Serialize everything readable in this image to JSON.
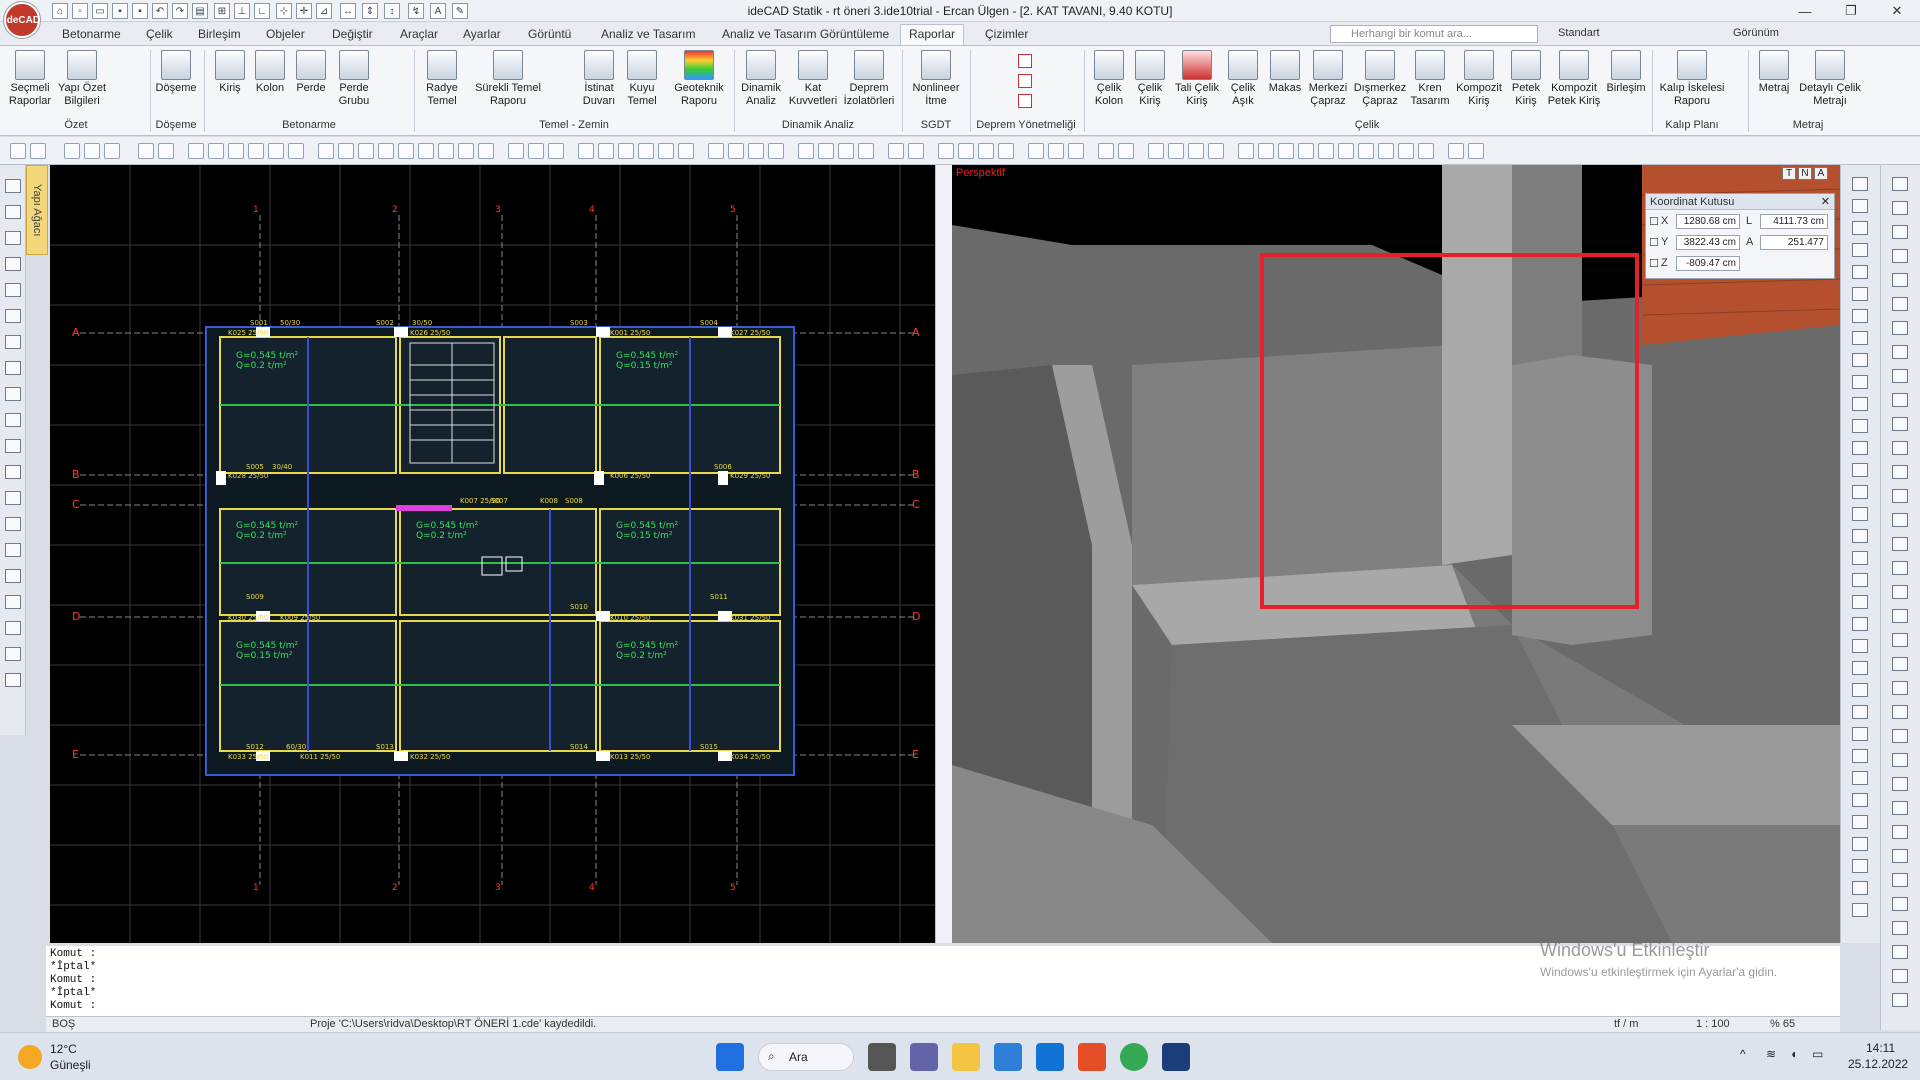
{
  "window": {
    "title": "ideCAD Statik - rt öneri 3.ide10trial - Ercan Ülgen - [2. KAT TAVANI,  9.40 KOTU]",
    "logo": "ideCAD"
  },
  "tabs": [
    "Betonarme",
    "Çelik",
    "Birleşim",
    "Objeler",
    "Değiştir",
    "Araçlar",
    "Ayarlar",
    "Görüntü",
    "Analiz ve Tasarım",
    "Analiz ve Tasarım Görüntüleme",
    "Raporlar",
    "Çizimler"
  ],
  "active_tab": "Raporlar",
  "search": {
    "placeholder": "Herhangi bir komut ara..."
  },
  "style_select": "Standart",
  "view_menu": "Görünüm",
  "ribbon": {
    "buttons": [
      {
        "label": "Seçmeli Raporlar"
      },
      {
        "label": "Yapı Özet Bilgileri"
      },
      {
        "label": "Döşeme"
      },
      {
        "label": "Kiriş"
      },
      {
        "label": "Kolon"
      },
      {
        "label": "Perde"
      },
      {
        "label": "Perde Grubu"
      },
      {
        "label": "Radye Temel"
      },
      {
        "label": "Sürekli Temel Raporu"
      },
      {
        "label": "İstinat Duvarı"
      },
      {
        "label": "Kuyu Temel"
      },
      {
        "label": "Geoteknik Raporu"
      },
      {
        "label": "Dinamik Analiz"
      },
      {
        "label": "Kat Kuvvetleri"
      },
      {
        "label": "Deprem İzolatörleri"
      },
      {
        "label": "Nonlineer İtme"
      },
      {
        "label": "Çelik Kolon"
      },
      {
        "label": "Çelik Kiriş"
      },
      {
        "label": "Tali Çelik Kiriş"
      },
      {
        "label": "Çelik Aşık"
      },
      {
        "label": "Makas"
      },
      {
        "label": "Merkezi Çapraz"
      },
      {
        "label": "Dışmerkez Çapraz"
      },
      {
        "label": "Kren Tasarım"
      },
      {
        "label": "Kompozit Kiriş"
      },
      {
        "label": "Petek Kiriş"
      },
      {
        "label": "Kompozit Petek Kiriş"
      },
      {
        "label": "Birleşim"
      },
      {
        "label": "Kalıp İskelesi Raporu"
      },
      {
        "label": "Metraj"
      },
      {
        "label": "Detaylı Çelik Metrajı"
      }
    ],
    "groups": [
      "Özet",
      "Döşeme",
      "Betonarme",
      "Temel - Zemin",
      "Dinamik Analiz",
      "SGDT",
      "Deprem Yönetmeliği",
      "Çelik",
      "Kalıp Planı",
      "Metraj"
    ]
  },
  "side_tab": "Yapı Ağacı",
  "perspective_label": "Perspektif",
  "view_cube": [
    "T",
    "N",
    "A"
  ],
  "plan": {
    "axes_cols": [
      "1",
      "2",
      "3",
      "4",
      "5"
    ],
    "axes_rows": [
      "A",
      "B",
      "C",
      "D",
      "E"
    ],
    "slab_loads": [
      "G=0.545 t/m²",
      "Q=0.2 t/m²",
      "G=0.545 t/m²",
      "Q=0.15 t/m²",
      "G=0.545 t/m²",
      "Q=0.2 t/m²",
      "G=0.545 t/m²",
      "Q=0.15 t/m²"
    ],
    "beam_labels": [
      "K025 25/50",
      "K026 25/50",
      "K001 25/50",
      "K027 25/50",
      "K028 25/50",
      "K006 25/50",
      "K029 25/50",
      "K007 25/50",
      "K008",
      "K030 25/50",
      "K009 25/50",
      "K010 25/50",
      "K031 25/50",
      "K033 25/50",
      "K011 25/50",
      "K032 25/50",
      "K013 25/50",
      "K034 25/50"
    ],
    "column_labels": [
      "S001",
      "50/30",
      "S002",
      "30/50",
      "S003",
      "S004",
      "S005",
      "30/40",
      "S006",
      "S007",
      "S008",
      "S009",
      "S010",
      "S011",
      "S012",
      "60/30",
      "S013",
      "S014",
      "S015"
    ]
  },
  "coord_box": {
    "title": "Koordinat Kutusu",
    "x": "1280.68 cm",
    "y": "3822.43 cm",
    "z": "-809.47 cm",
    "l": "4111.73 cm",
    "a": "251.477",
    "xl": "X",
    "yl": "Y",
    "zl": "Z",
    "ll": "L",
    "al": "A"
  },
  "command_lines": [
    "Komut :",
    "*İptal*",
    "Komut :",
    "*İptal*",
    "Komut :"
  ],
  "status": {
    "mode": "BOŞ",
    "message": "Proje 'C:\\Users\\ridva\\Desktop\\RT ÖNERİ 1.cde' kaydedildi.",
    "unit": "tf / m",
    "scale": "1 : 100",
    "zoom": "% 65"
  },
  "watermark": {
    "line1": "Windows'u Etkinleştir",
    "line2": "Windows'u etkinleştirmek için Ayarlar'a gidin."
  },
  "taskbar": {
    "weather_temp": "12°C",
    "weather_desc": "Güneşli",
    "search": "Ara",
    "time": "14:11",
    "date": "25.12.2022"
  },
  "colors": {
    "plan_bg": "#000000",
    "beam": "#e8d84a",
    "grid_axis": "#ff3b30",
    "slab_text": "#33e05a",
    "highlight": "#e5202a"
  }
}
